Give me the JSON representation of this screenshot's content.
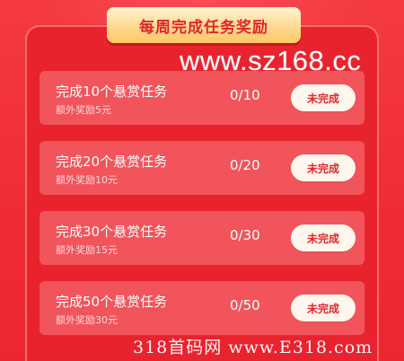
{
  "header": {
    "title": "每周完成任务奖励"
  },
  "watermarks": {
    "top": "www.sz168.cc",
    "bottom": "318首码网 www.E318.com"
  },
  "tasks": [
    {
      "title": "完成10个悬赏任务",
      "reward": "额外奖励5元",
      "progress": "0/10",
      "status": "未完成"
    },
    {
      "title": "完成20个悬赏任务",
      "reward": "额外奖励10元",
      "progress": "0/20",
      "status": "未完成"
    },
    {
      "title": "完成30个悬赏任务",
      "reward": "额外奖励15元",
      "progress": "0/30",
      "status": "未完成"
    },
    {
      "title": "完成50个悬赏任务",
      "reward": "额外奖励30元",
      "progress": "0/50",
      "status": "未完成"
    }
  ],
  "colors": {
    "background": "#f02f3a",
    "row": "#f2545b",
    "badge": "#ffd98f",
    "accent": "#e2262c"
  }
}
